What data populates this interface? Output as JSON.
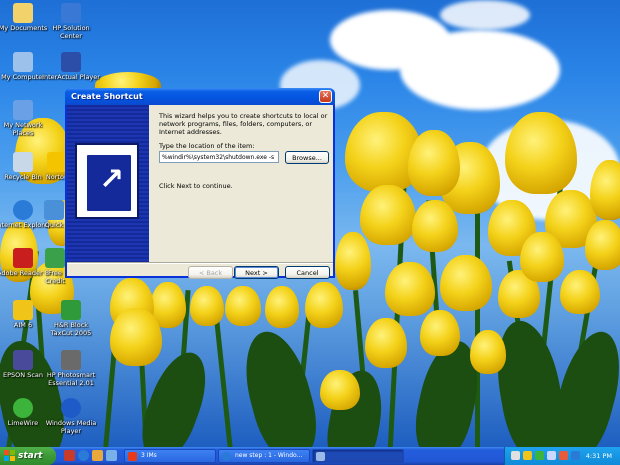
{
  "desktop": {
    "icons": [
      {
        "label": "My Documents",
        "icon": "folder-documents-icon",
        "color": "#f2d26a"
      },
      {
        "label": "HP Solution Center",
        "icon": "hp-solution-center-icon",
        "color": "#3a78d6"
      },
      {
        "label": "My Computer",
        "icon": "my-computer-icon",
        "color": "#9cc1ea"
      },
      {
        "label": "InterActual Player",
        "icon": "interactual-player-icon",
        "color": "#2c4ea8"
      },
      {
        "label": "My Network Places",
        "icon": "network-places-icon",
        "color": "#6aa0e6"
      },
      {
        "label": "Recycle Bin",
        "icon": "recycle-bin-icon",
        "color": "#c8d8e8"
      },
      {
        "label": "Norton",
        "icon": "norton-icon",
        "color": "#f5c400"
      },
      {
        "label": "Internet Explorer",
        "icon": "internet-explorer-icon",
        "color": "#2a7ad8"
      },
      {
        "label": "Quick",
        "icon": "quick-icon",
        "color": "#4a90d9"
      },
      {
        "label": "Adobe Reader 8",
        "icon": "adobe-reader-icon",
        "color": "#c81e1e"
      },
      {
        "label": "Free Credit",
        "icon": "free-credit-icon",
        "color": "#3aa04a"
      },
      {
        "label": "AIM 6",
        "icon": "aim-icon",
        "color": "#f0c419"
      },
      {
        "label": "H&R Block TaxCut 2005",
        "icon": "taxcut-icon",
        "color": "#2f9a3a"
      },
      {
        "label": "EPSON Scan",
        "icon": "epson-scan-icon",
        "color": "#4a4a9a"
      },
      {
        "label": "HP Photosmart Essential 2.01",
        "icon": "hp-photosmart-icon",
        "color": "#6a6a6a"
      },
      {
        "label": "LimeWire",
        "icon": "limewire-icon",
        "color": "#3cb43c"
      },
      {
        "label": "Windows Media Player",
        "icon": "windows-media-player-icon",
        "color": "#1e5ac8"
      }
    ]
  },
  "dialog": {
    "title": "Create Shortcut",
    "close_glyph": "✕",
    "intro": "This wizard helps you to create shortcuts to local or network programs, files, folders, computers, or Internet addresses.",
    "location_label": "Type the location of the item:",
    "location_value": "%windir%\\system32\\shutdown.exe -s",
    "browse_label": "Browse...",
    "continue_text": "Click Next to continue.",
    "back_label": "< Back",
    "next_label": "Next >",
    "cancel_label": "Cancel"
  },
  "taskbar": {
    "start_label": "start",
    "tasks": [
      {
        "label": "3 IMs",
        "icon": "aim-icon",
        "color": "#e83a1a"
      },
      {
        "label": "new step : 1 - Windo...",
        "icon": "internet-explorer-icon",
        "color": "#2a7ad8"
      },
      {
        "label": "",
        "icon": "shortcut-icon",
        "color": "#9ab8e8"
      }
    ],
    "clock": "4:31 PM"
  },
  "colors": {
    "title_bar": "#0454e0",
    "wizard_panel": "#14299a",
    "taskbar": "#245edc",
    "start_button": "#3c9a36",
    "tray": "#0f8ad8"
  }
}
